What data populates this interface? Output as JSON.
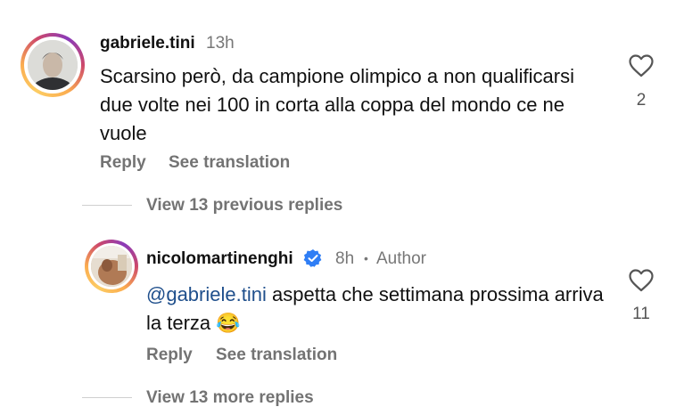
{
  "comment": {
    "username": "gabriele.tini",
    "time": "13h",
    "text": "Scarsino però, da campione olimpico a non qualificarsi due volte nei 100 in corta alla coppa del mondo ce ne vuole",
    "like_count": "2",
    "reply_label": "Reply",
    "translate_label": "See translation"
  },
  "previous_replies_label": "View 13 previous replies",
  "reply": {
    "username": "nicolomartinenghi",
    "verified_icon": "verified-badge-icon",
    "time": "8h",
    "separator": "•",
    "author_label": "Author",
    "mention": "@gabriele.tini",
    "text": "aspetta che settimana prossima arriva la terza",
    "emoji": "😂",
    "like_count": "11",
    "reply_label": "Reply",
    "translate_label": "See translation"
  },
  "more_replies_label": "View 13 more replies",
  "colors": {
    "verified": "#2f7ef5",
    "mention": "#1f4f8c",
    "muted": "#737373"
  }
}
